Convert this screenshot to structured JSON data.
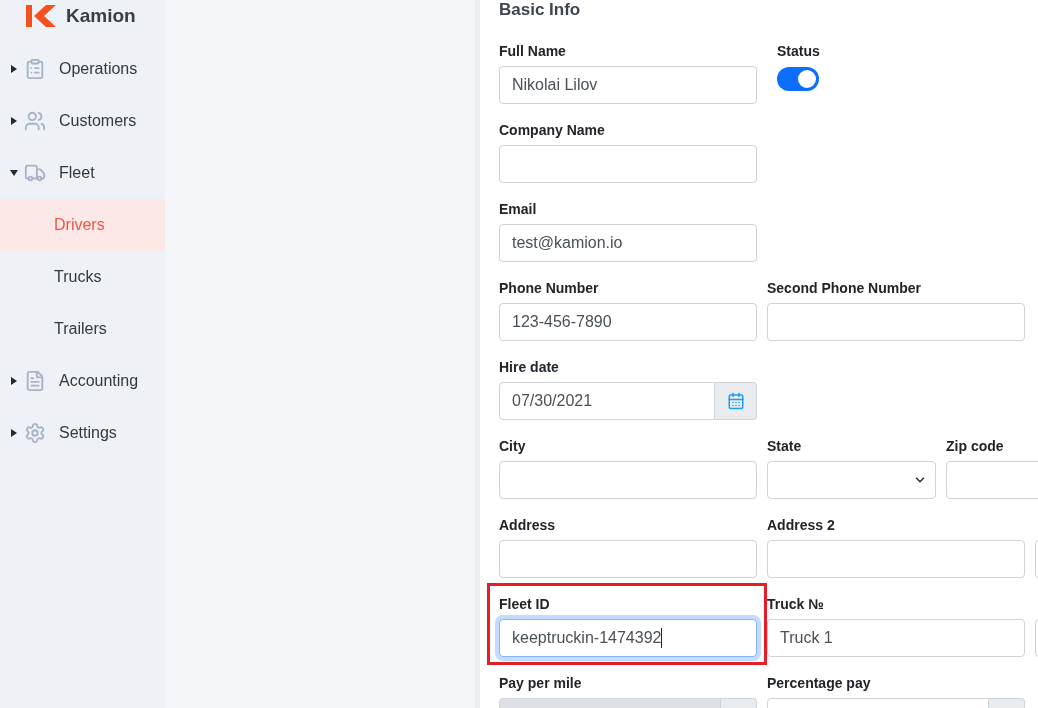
{
  "sidebar": {
    "brand": "Kamion",
    "items": [
      {
        "label": "Operations",
        "expanded": false
      },
      {
        "label": "Customers",
        "expanded": false
      },
      {
        "label": "Fleet",
        "expanded": true,
        "children": [
          {
            "label": "Drivers",
            "selected": true
          },
          {
            "label": "Trucks",
            "selected": false
          },
          {
            "label": "Trailers",
            "selected": false
          }
        ]
      },
      {
        "label": "Accounting",
        "expanded": false
      },
      {
        "label": "Settings",
        "expanded": false
      }
    ]
  },
  "form": {
    "title": "Basic Info",
    "rows": [
      [
        {
          "kind": "text",
          "label": "Full Name",
          "value": "Nikolai Lilov"
        },
        {
          "kind": "toggle",
          "label": "Status",
          "on": true
        }
      ],
      [
        {
          "kind": "text",
          "label": "Company Name"
        }
      ],
      [
        {
          "kind": "text",
          "label": "Email",
          "value": "test@kamion.io"
        }
      ],
      [
        {
          "kind": "text",
          "label": "Phone Number",
          "value": "123-456-7890"
        },
        {
          "kind": "text",
          "label": "Second Phone Number"
        }
      ],
      [
        {
          "kind": "date",
          "label": "Hire date",
          "value": "07/30/2021"
        }
      ],
      [
        {
          "kind": "text",
          "label": "City"
        },
        {
          "kind": "select",
          "label": "State"
        },
        {
          "kind": "text",
          "label": "Zip code"
        }
      ],
      [
        {
          "kind": "text",
          "label": "Address"
        },
        {
          "kind": "text",
          "label": "Address 2"
        },
        {
          "kind": "text"
        }
      ],
      [
        {
          "kind": "text",
          "label": "Fleet ID",
          "value": "keeptruckin-1474392",
          "focused": true,
          "highlighted": true
        },
        {
          "kind": "text",
          "label": "Truck №",
          "value": "Truck 1"
        },
        {
          "kind": "text"
        }
      ],
      [
        {
          "kind": "addon",
          "label": "Pay per mile",
          "disabled": true
        },
        {
          "kind": "addon",
          "label": "Percentage pay",
          "disabled": false
        }
      ]
    ]
  }
}
